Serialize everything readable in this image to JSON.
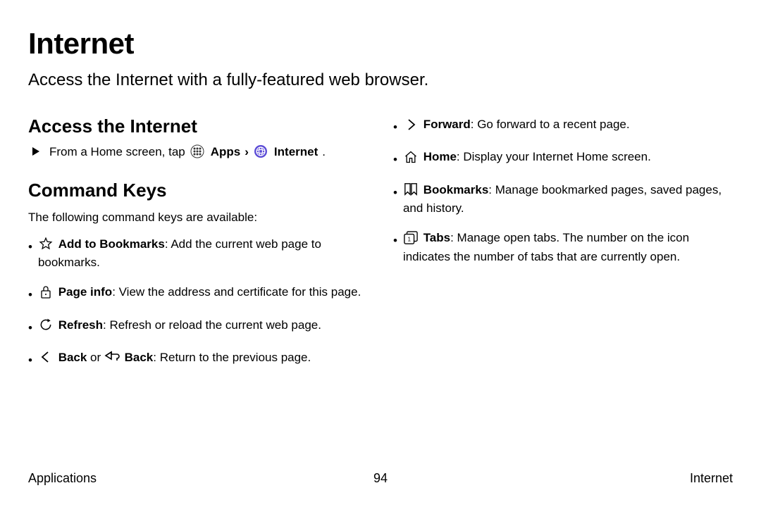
{
  "title": "Internet",
  "intro": "Access the Internet with a fully-featured web browser.",
  "left": {
    "accessHeading": "Access the Internet",
    "accessLine_prefix": "From a Home screen, tap",
    "accessLine_apps": "Apps",
    "accessLine_sep": "›",
    "accessLine_internet": "Internet",
    "accessLine_period": ".",
    "cmdHeading": "Command Keys",
    "cmdIntro": "The following command keys are available:",
    "b1_label": "Add to Bookmarks",
    "b1_text": ": Add the current web page to bookmarks.",
    "b2_label": "Page info",
    "b2_text": ": View the address and certificate for this page.",
    "b3_label": "Refresh",
    "b3_text": ": Refresh or reload the current web page.",
    "b4_label1": "Back",
    "b4_or": " or ",
    "b4_label2": "Back",
    "b4_text": ": Return to the previous page."
  },
  "right": {
    "b5_label": "Forward",
    "b5_text": ": Go forward to a recent page.",
    "b6_label": "Home",
    "b6_text": ": Display your Internet Home screen.",
    "b7_label": "Bookmarks",
    "b7_text": ": Manage bookmarked pages, saved pages, and history.",
    "b8_label": "Tabs",
    "b8_text": ": Manage open tabs. The number on the icon indicates the number of tabs that are currently open."
  },
  "footer": {
    "left": "Applications",
    "center": "94",
    "right": "Internet"
  }
}
